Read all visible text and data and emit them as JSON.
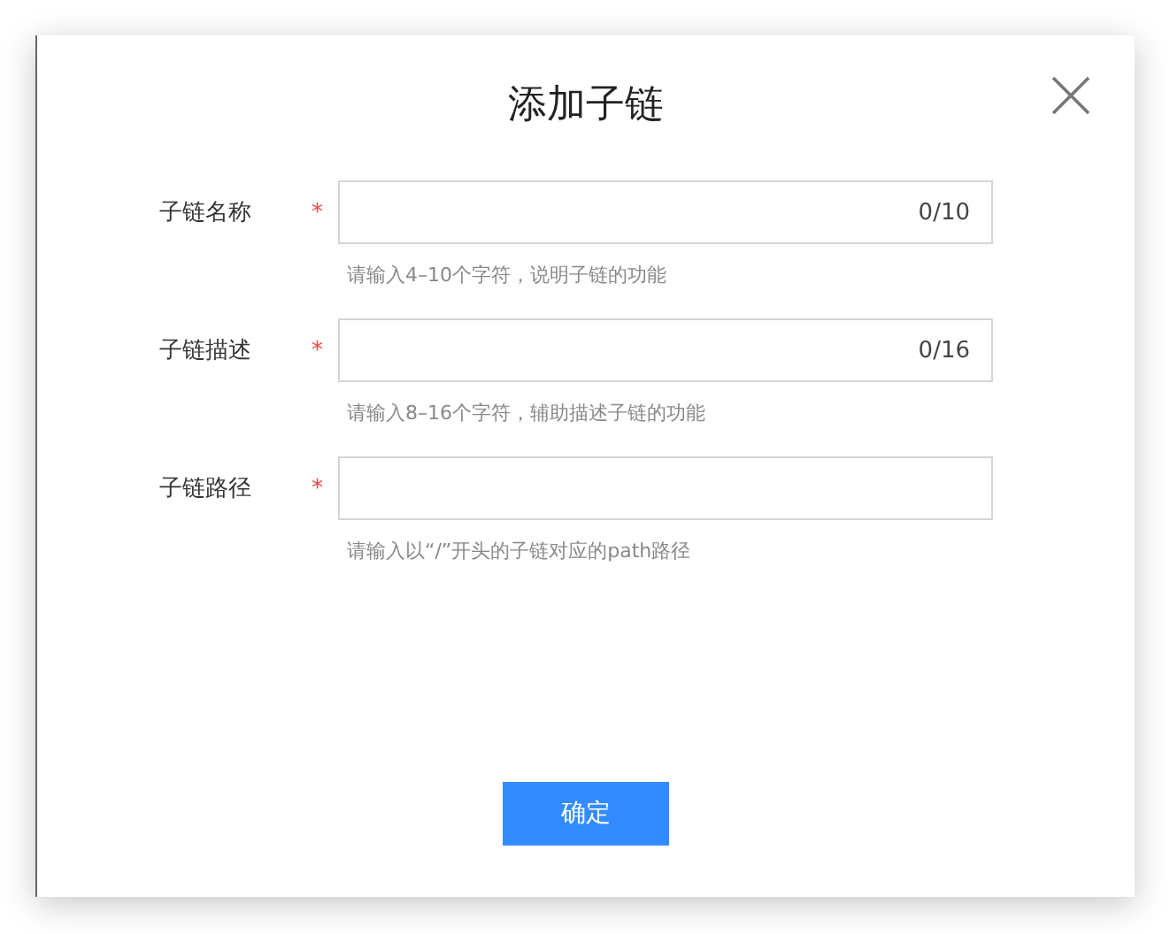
{
  "dialog": {
    "title": "添加子链",
    "fields": [
      {
        "label": "子链名称",
        "required_mark": "*",
        "counter": "0/10",
        "hint": "请输入4–10个字符，说明子链的功能"
      },
      {
        "label": "子链描述",
        "required_mark": "*",
        "counter": "0/16",
        "hint": "请输入8–16个字符，辅助描述子链的功能"
      },
      {
        "label": "子链路径",
        "required_mark": "*",
        "hint": "请输入以“/”开头的子链对应的path路径"
      }
    ],
    "confirm_button": "确定"
  }
}
